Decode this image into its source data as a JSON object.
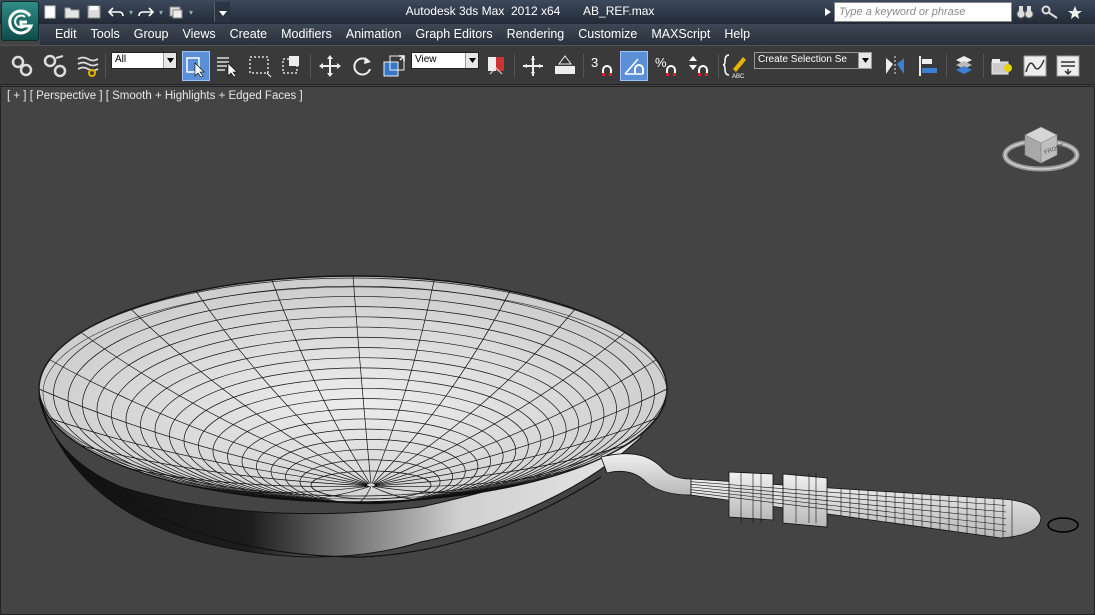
{
  "titlebar": {
    "title": "Autodesk 3ds Max  2012 x64       AB_REF.max",
    "search_placeholder": "Type a keyword or phrase",
    "quick_access": [
      "new-file-icon",
      "open-file-icon",
      "save-icon",
      "undo-icon",
      "redo-icon",
      "project-folder-icon"
    ],
    "right_icons": [
      "binoculars-icon",
      "key-icon",
      "star-icon"
    ]
  },
  "menu": [
    "Edit",
    "Tools",
    "Group",
    "Views",
    "Create",
    "Modifiers",
    "Animation",
    "Graph Editors",
    "Rendering",
    "Customize",
    "MAXScript",
    "Help"
  ],
  "toolbar": {
    "selection_filter": "All",
    "reference_coord": "View",
    "named_selection": "Create Selection Se",
    "snap_label": "3",
    "icons": [
      "link-icon",
      "unlink-icon",
      "bind-space-warp-icon",
      "select-object-icon",
      "select-by-name-icon",
      "rect-selection-icon",
      "window-crossing-icon",
      "move-icon",
      "rotate-icon",
      "scale-icon",
      "mirror-pick-icon",
      "pivot-icon",
      "manipulate-icon",
      "snap-toggle-icon",
      "angle-snap-icon",
      "percent-snap-icon",
      "spinner-snap-icon",
      "edit-named-selection-icon",
      "mirror-icon",
      "align-icon",
      "layer-manager-icon",
      "scene-explorer-icon",
      "curve-editor-icon",
      "schematic-view-icon"
    ]
  },
  "viewport": {
    "label": "[ + ] [ Perspective ] [ Smooth + Highlights + Edged Faces ]",
    "viewcube_face": "FRONT",
    "background": "#444444"
  },
  "colors": {
    "titlebar": "#2a3442",
    "active_tool": "#5b8fd6",
    "app_button": "#1f6e69",
    "mesh_fill": "#e6e6e6",
    "wire": "#111111"
  }
}
